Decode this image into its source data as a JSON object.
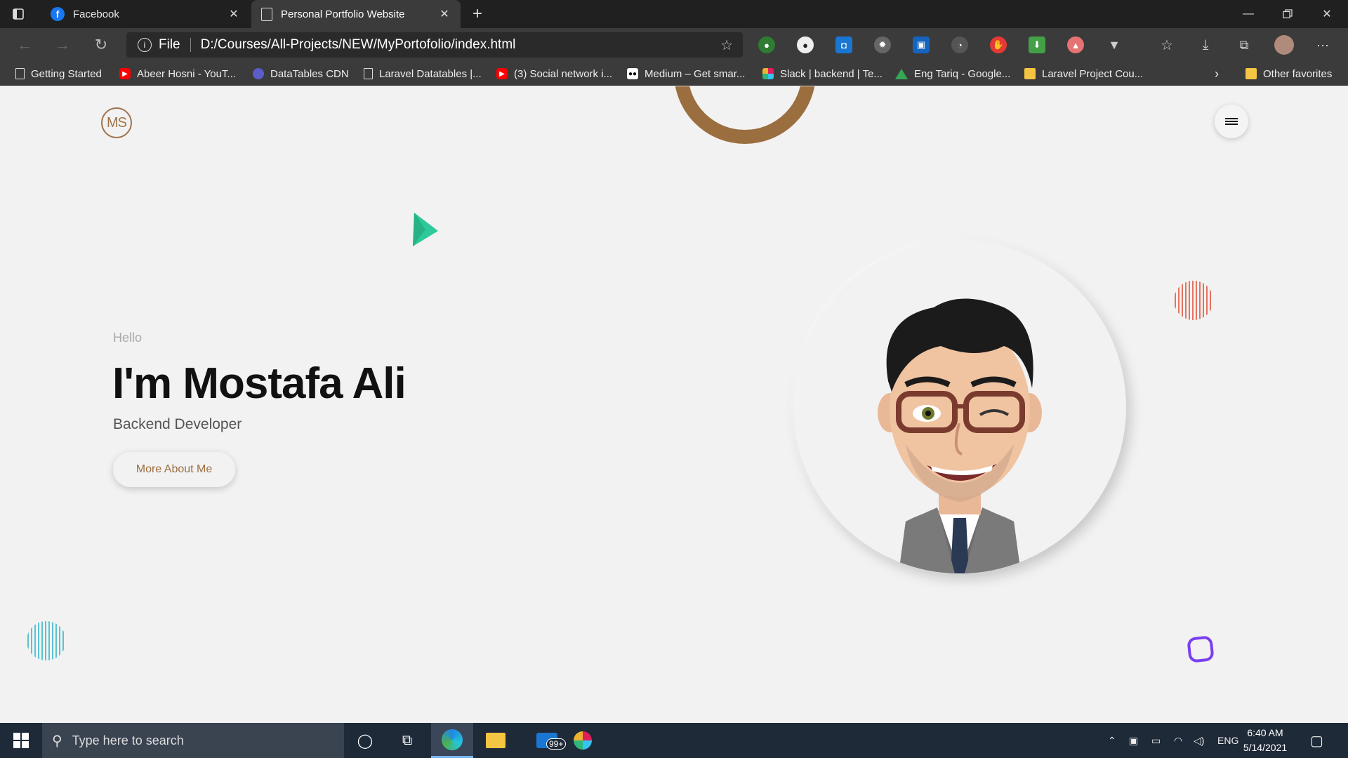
{
  "browser": {
    "tabs": [
      {
        "title": "Facebook",
        "icon": "facebook-icon"
      },
      {
        "title": "Personal Portfolio Website",
        "icon": "page-icon",
        "active": true
      }
    ],
    "address": {
      "scheme_label": "File",
      "url": "D:/Courses/All-Projects/NEW/MyPortofolio/index.html"
    },
    "bookmarks": [
      {
        "label": "Getting Started",
        "icon": "page-icon"
      },
      {
        "label": "Abeer Hosni - YouT...",
        "icon": "youtube-icon"
      },
      {
        "label": "DataTables CDN",
        "icon": "datatables-icon"
      },
      {
        "label": "Laravel Datatables |...",
        "icon": "page-icon"
      },
      {
        "label": "(3) Social network i...",
        "icon": "youtube-icon"
      },
      {
        "label": "Medium – Get smar...",
        "icon": "medium-icon"
      },
      {
        "label": "Slack | backend | Te...",
        "icon": "slack-icon"
      },
      {
        "label": "Eng Tariq - Google...",
        "icon": "drive-icon"
      },
      {
        "label": "Laravel Project Cou...",
        "icon": "folder-icon"
      }
    ],
    "other_favorites": "Other favorites"
  },
  "page": {
    "logo_text": "MS",
    "hello": "Hello",
    "name": "I'm Mostafa Ali",
    "role": "Backend Developer",
    "cta": "More About Me"
  },
  "taskbar": {
    "search_placeholder": "Type here to search",
    "mail_badge": "99+",
    "language": "ENG",
    "time": "6:40 AM",
    "date": "5/14/2021"
  },
  "colors": {
    "accent_brown": "#9b6e3f",
    "deco_green": "#2ec99a",
    "deco_red": "#e0533a",
    "deco_cyan": "#35b7c8",
    "deco_purple": "#7a3ff0"
  }
}
